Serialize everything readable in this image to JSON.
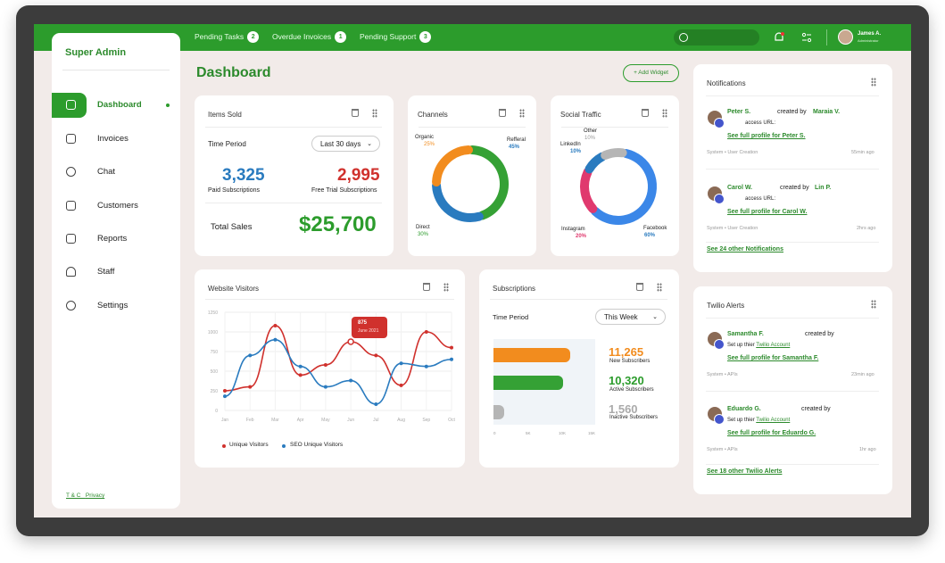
{
  "topbar": {
    "pills": [
      {
        "label": "Pending Tasks",
        "count": "2"
      },
      {
        "label": "Overdue Invoices",
        "count": "1"
      },
      {
        "label": "Pending Support",
        "count": "3"
      }
    ],
    "user_name": "James A.",
    "user_role": "Administrator"
  },
  "sidebar": {
    "brand": "Super Admin",
    "items": [
      {
        "label": "Dashboard",
        "icon": "grid-icon"
      },
      {
        "label": "Invoices",
        "icon": "folder-icon"
      },
      {
        "label": "Chat",
        "icon": "chat-icon"
      },
      {
        "label": "Customers",
        "icon": "customers-icon"
      },
      {
        "label": "Reports",
        "icon": "report-icon"
      },
      {
        "label": "Staff",
        "icon": "staff-icon"
      },
      {
        "label": "Settings",
        "icon": "gear-icon"
      }
    ],
    "footer_tc": "T & C",
    "footer_privacy": "Privacy"
  },
  "header": {
    "title": "Dashboard",
    "add_widget": "+ Add Widget"
  },
  "items_sold": {
    "title": "Items Sold",
    "period_label": "Time Period",
    "period_value": "Last 30 days",
    "paid_value": "3,325",
    "paid_label": "Paid Subscriptions",
    "trial_value": "2,995",
    "trial_label": "Free Trial Subscriptions",
    "total_label": "Total Sales",
    "total_value": "$25,700"
  },
  "channels": {
    "title": "Channels",
    "organic": "Organic",
    "organic_pct": "25%",
    "referral": "Refferal",
    "referral_pct": "45%",
    "direct": "Direct",
    "direct_pct": "30%"
  },
  "social": {
    "title": "Social Traffic",
    "other": "Other",
    "other_pct": "10%",
    "linkedin": "LinkedIn",
    "linkedin_pct": "10%",
    "instagram": "Instagram",
    "instagram_pct": "20%",
    "facebook": "Facebook",
    "facebook_pct": "60%"
  },
  "visitors": {
    "title": "Website Visitors",
    "tooltip_value": "875",
    "tooltip_date": "June 2021",
    "legend_unique": "Unique Visitors",
    "legend_seo": "SEO Unique Visitors"
  },
  "subscriptions": {
    "title": "Subscriptions",
    "period_label": "Time Period",
    "period_value": "This Week",
    "new_value": "11,265",
    "new_label": "New Subscribers",
    "active_value": "10,320",
    "active_label": "Active Subscribers",
    "inactive_value": "1,560",
    "inactive_label": "Inactive Subscribers",
    "x_ticks": [
      "0",
      "5K",
      "10K",
      "15K"
    ]
  },
  "notifications": {
    "title": "Notifications",
    "items": [
      {
        "name": "Peter S.",
        "verb": "created by",
        "by": "Maraia V.",
        "sub": "access URL:",
        "link": "See full profile for Peter S.",
        "meta": "System  •  User Creation",
        "time": "55min ago"
      },
      {
        "name": "Carol W.",
        "verb": "created by",
        "by": "Lin P.",
        "sub": "access URL:",
        "link": "See full profile for Carol W.",
        "meta": "System  •  User Creation",
        "time": "2hrs ago"
      }
    ],
    "more": "See 24 other Notifications"
  },
  "twilio": {
    "title": "Twilio Alerts",
    "items": [
      {
        "name": "Samantha F.",
        "verb": "created by",
        "sub": "Set up thier",
        "sublink": "Twilio Account",
        "link": "See full profile for Samantha F.",
        "meta": "System  •  APIs",
        "time": "23min ago"
      },
      {
        "name": "Eduardo G.",
        "verb": "created by",
        "sub": "Set up thier",
        "sublink": "Twilio Account",
        "link": "See full profile for Eduardo G.",
        "meta": "System  •  APIs",
        "time": "1hr ago"
      }
    ],
    "more": "See 18 other Twilio Alerts"
  },
  "colors": {
    "brand": "#2c9c2c",
    "blue": "#2a7bbf",
    "red": "#d0312d",
    "orange": "#f28c1e"
  },
  "chart_data": [
    {
      "type": "line",
      "x": [
        "Jan",
        "Feb",
        "Mar",
        "Apr",
        "May",
        "Jun",
        "Jul",
        "Aug",
        "Sep",
        "Oct"
      ],
      "y_ticks": [
        "0",
        "250",
        "500",
        "750",
        "1000",
        "1250"
      ],
      "ylim": [
        0,
        1250
      ],
      "series": [
        {
          "name": "Unique Visitors",
          "color": "#d0312d",
          "values": [
            250,
            300,
            1080,
            450,
            580,
            875,
            700,
            320,
            1000,
            800
          ]
        },
        {
          "name": "SEO Unique Visitors",
          "color": "#2a7bbf",
          "values": [
            180,
            700,
            900,
            560,
            300,
            380,
            80,
            600,
            560,
            650
          ]
        }
      ]
    },
    {
      "type": "pie",
      "labels": [
        "Refferal",
        "Direct",
        "Organic"
      ],
      "values": [
        45,
        30,
        25
      ],
      "colors": [
        "#35a135",
        "#2a7bbf",
        "#f28c1e"
      ]
    },
    {
      "type": "pie",
      "labels": [
        "Facebook",
        "Instagram",
        "LinkedIn",
        "Other"
      ],
      "values": [
        60,
        20,
        10,
        10
      ],
      "colors": [
        "#3b87e8",
        "#e0396e",
        "#2a7bbf",
        "#b5b5b5"
      ]
    },
    {
      "type": "bar",
      "categories": [
        "New Subscribers",
        "Active Subscribers",
        "Inactive Subscribers"
      ],
      "values": [
        11265,
        10320,
        1560
      ],
      "colors": [
        "#f28c1e",
        "#35a135",
        "#b5b5b5"
      ],
      "xlim": [
        0,
        15000
      ]
    }
  ]
}
